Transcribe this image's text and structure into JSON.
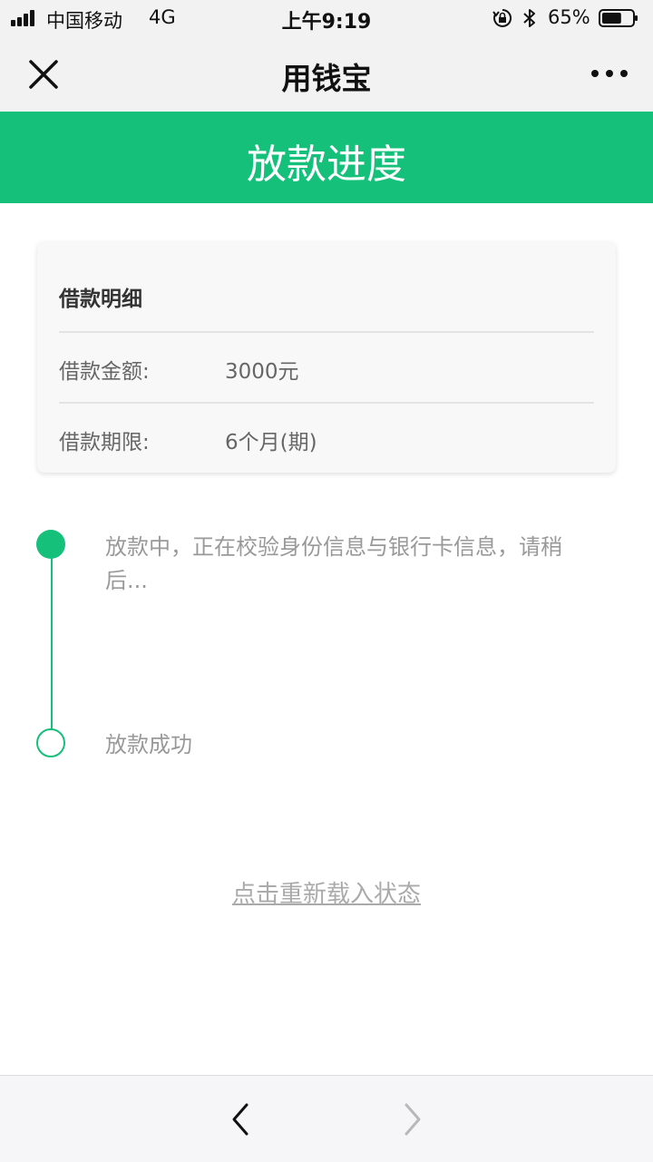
{
  "status_bar": {
    "carrier": "中国移动",
    "network": "4G",
    "time": "上午9:19",
    "battery_percent": "65%",
    "battery_level": 0.65,
    "icons": [
      "signal-icon",
      "orientation-lock-icon",
      "bluetooth-icon",
      "battery-icon"
    ]
  },
  "header": {
    "title": "用钱宝",
    "close_icon": "close-icon",
    "more_icon": "more-icon"
  },
  "banner": {
    "title": "放款进度"
  },
  "loan_card": {
    "title": "借款明细",
    "rows": [
      {
        "label": "借款金额:",
        "value": "3000元"
      },
      {
        "label": "借款期限:",
        "value": "6个月(期)"
      }
    ]
  },
  "timeline": {
    "steps": [
      {
        "text": "放款中，正在校验身份信息与银行卡信息，请稍后...",
        "status": "active"
      },
      {
        "text": "放款成功",
        "status": "pending"
      }
    ]
  },
  "reload_link": "点击重新载入状态",
  "bottom_bar": {
    "back_icon": "chevron-left-icon",
    "forward_icon": "chevron-right-icon"
  },
  "colors": {
    "accent": "#14c07a",
    "header_bg": "#f2f2f2",
    "muted_text": "#999999"
  }
}
